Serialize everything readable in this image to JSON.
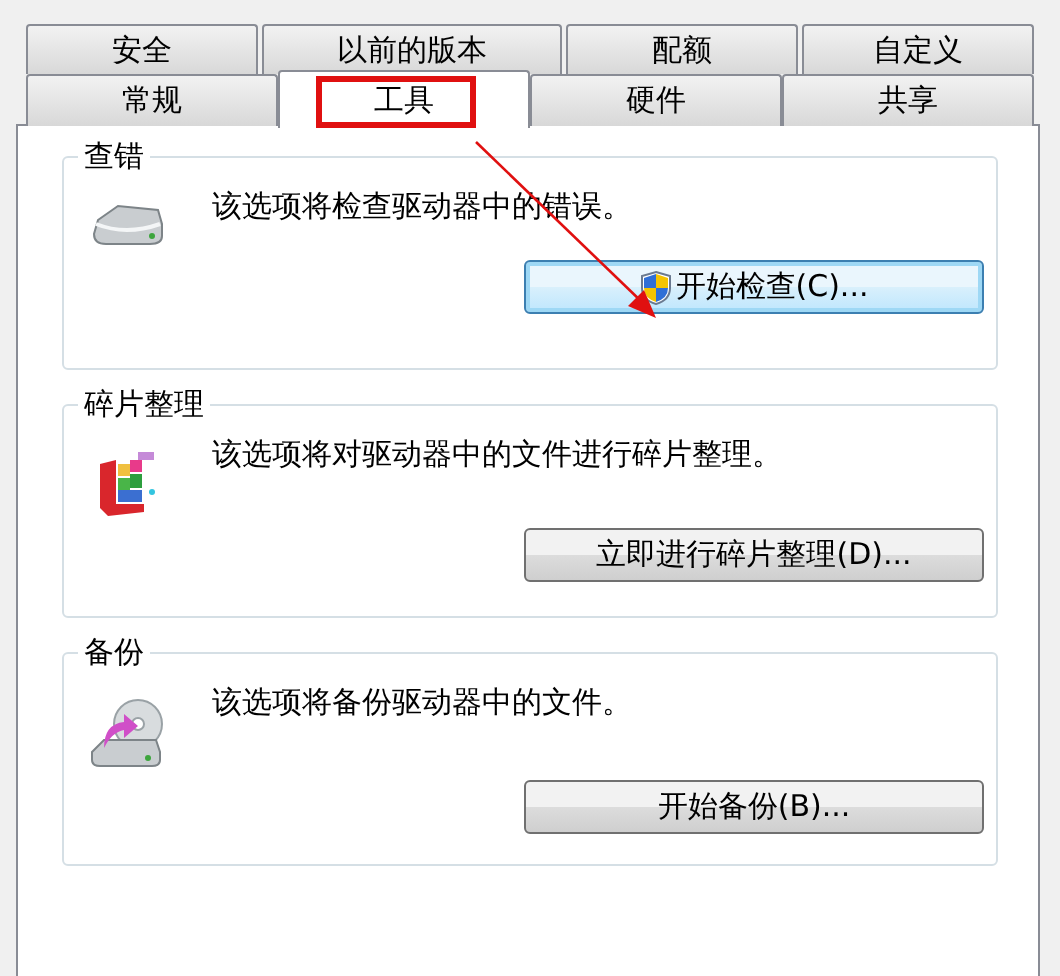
{
  "tab_rows": [
    [
      {
        "label": "安全",
        "selected": false,
        "highlighted": false
      },
      {
        "label": "以前的版本",
        "selected": false,
        "highlighted": false
      },
      {
        "label": "配额",
        "selected": false,
        "highlighted": false
      },
      {
        "label": "自定义",
        "selected": false,
        "highlighted": false
      }
    ],
    [
      {
        "label": "常规",
        "selected": false,
        "highlighted": false
      },
      {
        "label": "工具",
        "selected": true,
        "highlighted": true
      },
      {
        "label": "硬件",
        "selected": false,
        "highlighted": false
      },
      {
        "label": "共享",
        "selected": false,
        "highlighted": false
      }
    ]
  ],
  "groups": [
    {
      "title": "查错",
      "kind": "drive",
      "description": "该选项将检查驱动器中的错误。",
      "button": {
        "label": "开始检查(C)...",
        "shield": true,
        "focused": true
      }
    },
    {
      "title": "碎片整理",
      "kind": "defrag",
      "description": "该选项将对驱动器中的文件进行碎片整理。",
      "button": {
        "label": "立即进行碎片整理(D)...",
        "shield": false,
        "focused": false
      }
    },
    {
      "title": "备份",
      "kind": "backup",
      "description": "该选项将备份驱动器中的文件。",
      "button": {
        "label": "开始备份(B)...",
        "shield": false,
        "focused": false
      }
    }
  ]
}
